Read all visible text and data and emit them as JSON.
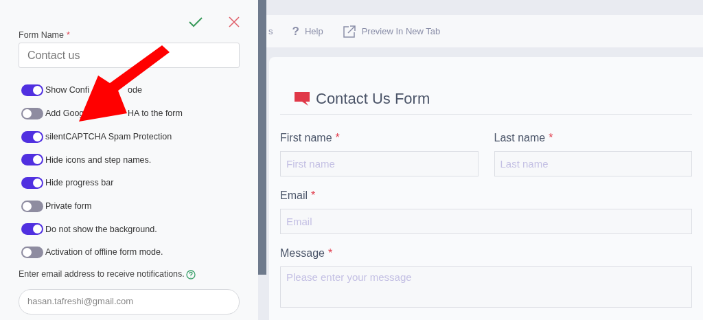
{
  "settings_panel": {
    "form_name_label": "Form Name",
    "form_name_required_mark": "*",
    "form_name_value": "Contact us",
    "options": [
      {
        "label_parts": [
          "Show Confi",
          "ode"
        ],
        "on": true
      },
      {
        "label_parts": [
          "Add Goog",
          "HA to the form"
        ],
        "on": false
      },
      {
        "label": "silentCAPTCHA Spam Protection",
        "on": true
      },
      {
        "label": "Hide icons and step names.",
        "on": true
      },
      {
        "label": "Hide progress bar",
        "on": true
      },
      {
        "label": "Private form",
        "on": false
      },
      {
        "label": "Do not show the background.",
        "on": true
      },
      {
        "label": "Activation of offline form mode.",
        "on": false
      }
    ],
    "email_label": "Enter email address to receive notifications.",
    "email_value": "hasan.tafreshi@gmail.com"
  },
  "annotation": {
    "kind": "arrow"
  },
  "toolbar": [
    {
      "kind": "plain",
      "label": "s"
    },
    {
      "kind": "help",
      "icon_text": "?",
      "label": "Help"
    },
    {
      "kind": "preview",
      "label": "Preview In New Tab"
    }
  ],
  "form": {
    "title": "Contact Us Form",
    "fields": [
      {
        "label": "First name",
        "required_mark": "*",
        "placeholder": "First name",
        "kind": "half"
      },
      {
        "label": "Last name",
        "required_mark": "*",
        "placeholder": "Last name",
        "kind": "half"
      },
      {
        "label": "Email",
        "required_mark": "*",
        "placeholder": "Email",
        "kind": "full"
      },
      {
        "label": "Message",
        "required_mark": "*",
        "placeholder": "Please enter your message",
        "kind": "textarea"
      }
    ]
  }
}
